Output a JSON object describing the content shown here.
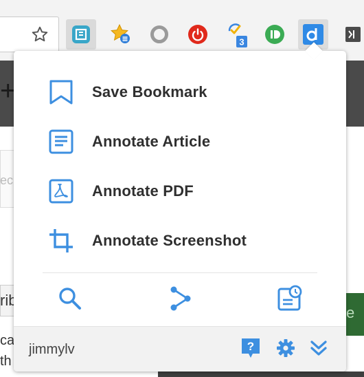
{
  "accent_color": "#3d8fe0",
  "toolbar": {
    "icons": [
      "star-icon",
      "extension-bookmark-icon",
      "extension-favorites-icon",
      "extension-ring-icon",
      "extension-power-icon",
      "extension-checklist-icon",
      "extension-id-icon",
      "extension-d-icon",
      "extension-window-icon"
    ],
    "badge": "3"
  },
  "background_page": {
    "fragment_a": "+",
    "fragment_b": "ec",
    "fragment_c": "rib",
    "fragment_d": "ca",
    "fragment_e": "th",
    "fragment_f": "e"
  },
  "popup": {
    "menu": [
      {
        "label": "Save Bookmark",
        "icon": "bookmark-icon"
      },
      {
        "label": "Annotate Article",
        "icon": "article-icon"
      },
      {
        "label": "Annotate PDF",
        "icon": "pdf-icon"
      },
      {
        "label": "Annotate Screenshot",
        "icon": "crop-icon"
      }
    ],
    "tools": [
      "search-icon",
      "share-icon",
      "notes-icon"
    ],
    "footer": {
      "username": "jimmylv",
      "icons": [
        "help-icon",
        "gear-icon",
        "chevron-down-icon"
      ]
    }
  }
}
